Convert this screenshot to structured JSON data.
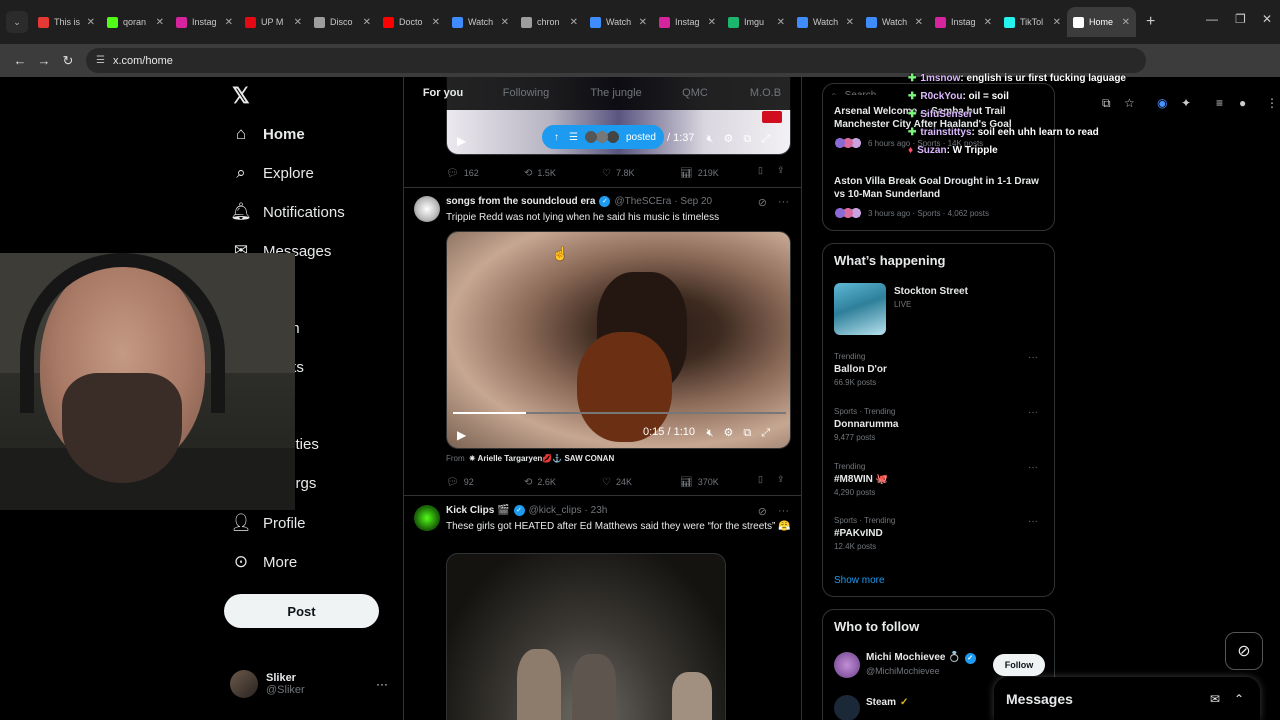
{
  "browser": {
    "tabs": [
      {
        "label": "This is",
        "color": "#e53935"
      },
      {
        "label": "qoran",
        "color": "#53fc18"
      },
      {
        "label": "Instag",
        "color": "#d6249f"
      },
      {
        "label": "UP M",
        "color": "#e50914"
      },
      {
        "label": "Disco",
        "color": "#9e9e9e"
      },
      {
        "label": "Docto",
        "color": "#ff0000"
      },
      {
        "label": "Watch",
        "color": "#3f8cff"
      },
      {
        "label": "chron",
        "color": "#9e9e9e"
      },
      {
        "label": "Watch",
        "color": "#3f8cff"
      },
      {
        "label": "Instag",
        "color": "#d6249f"
      },
      {
        "label": "Imgu",
        "color": "#1bb76e"
      },
      {
        "label": "Watch",
        "color": "#3f8cff"
      },
      {
        "label": "Watch",
        "color": "#3f8cff"
      },
      {
        "label": "Instag",
        "color": "#d6249f"
      },
      {
        "label": "TikTol",
        "color": "#25f4ee"
      },
      {
        "label": "Home",
        "color": "#ffffff"
      }
    ],
    "url": "x.com/home"
  },
  "nav": {
    "items": [
      {
        "label": "Home",
        "icon": "home-icon"
      },
      {
        "label": "Explore",
        "icon": "search-icon"
      },
      {
        "label": "Notifications",
        "icon": "bell-icon"
      },
      {
        "label": "Messages",
        "icon": "mail-icon"
      },
      {
        "label": "mium",
        "icon": "premium-icon"
      },
      {
        "label": "marks",
        "icon": "bookmark-icon"
      },
      {
        "label": "munities",
        "icon": "communities-icon"
      },
      {
        "label": "ed Orgs",
        "icon": "orgs-icon"
      },
      {
        "label": "Profile",
        "icon": "person-icon"
      },
      {
        "label": "More",
        "icon": "more-circle-icon"
      }
    ],
    "post_label": "Post",
    "user": {
      "name": "Sliker",
      "handle": "@Sliker"
    }
  },
  "feed": {
    "tabs": [
      "For you",
      "Following",
      "The jungle",
      "QMC",
      "M.O.B"
    ],
    "tweet0": {
      "posted_label": "posted",
      "time": "/ 1:37",
      "stats": {
        "replies": "162",
        "reposts": "1.5K",
        "likes": "7.8K",
        "views": "219K"
      }
    },
    "tweet1": {
      "name": "songs from the soundcloud era",
      "handle": "@TheSCEra",
      "date": "· Sep 20",
      "text": "Trippie Redd was not lying when he said his music is timeless",
      "video_time": "0:15 / 1:10",
      "from_label": "From",
      "from_text": "✷ Arielle Targaryen💋⚓ SAW CONAN",
      "stats": {
        "replies": "92",
        "reposts": "2.6K",
        "likes": "24K",
        "views": "370K"
      }
    },
    "tweet2": {
      "name": "Kick Clips 🎬",
      "handle": "@kick_clips",
      "date": "· 23h",
      "text": "These girls got HEATED after Ed Matthews said they were “for the streets” 😤"
    }
  },
  "right": {
    "search_placeholder": "Search",
    "news": [
      {
        "title": "Arsenal Welcome ... Samba but Trail Manchester City After Haaland's Goal",
        "meta": "6 hours ago · Sports · 14K posts"
      },
      {
        "title": "Aston Villa Break Goal Drought in 1-1 Draw vs 10-Man Sunderland",
        "meta": "3 hours ago · Sports · 4,062 posts"
      }
    ],
    "whats_happening": "What’s happening",
    "live": {
      "title": "Stockton Street",
      "badge": "LIVE"
    },
    "trends": [
      {
        "meta": "Trending",
        "name": "Ballon D'or",
        "count": "66.9K posts"
      },
      {
        "meta": "Sports · Trending",
        "name": "Donnarumma",
        "count": "9,477 posts"
      },
      {
        "meta": "Trending",
        "name": "#M8WIN 🐙",
        "count": "4,290 posts"
      },
      {
        "meta": "Sports · Trending",
        "name": "#PAKvIND",
        "count": "12.4K posts"
      }
    ],
    "show_more": "Show more",
    "who_to_follow": "Who to follow",
    "follow": [
      {
        "name": "Michi Mochievee 💍",
        "handle": "@MichiMochievee",
        "button": "Follow"
      },
      {
        "name": "Steam",
        "handle": ""
      }
    ]
  },
  "chat": [
    {
      "name": "1msnow",
      "text": ": english is ur first fucking laguage"
    },
    {
      "name": "R0ckYou",
      "text": ": oil = soil"
    },
    {
      "name": "SifuSensei",
      "text": ""
    },
    {
      "name": "trainstittys",
      "text": ": soil eeh uhh learn to read"
    },
    {
      "name": "Suzan",
      "text": ": W Tripple"
    }
  ],
  "messages": {
    "title": "Messages"
  }
}
